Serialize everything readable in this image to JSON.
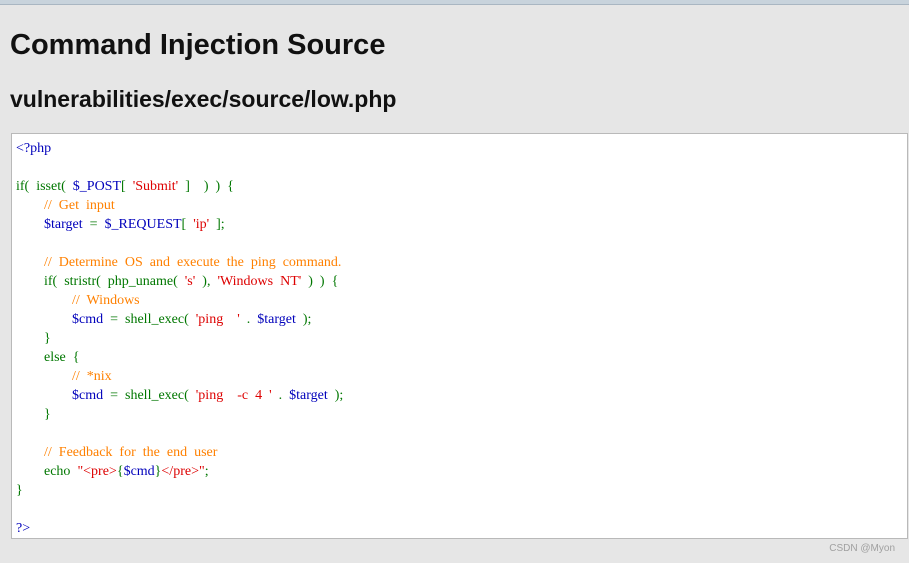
{
  "page": {
    "title": "Command Injection Source",
    "file_path": "vulnerabilities/exec/source/low.php"
  },
  "code": {
    "lines": [
      [
        {
          "t": "<?php",
          "c": "tag"
        }
      ],
      [],
      [
        {
          "t": "if(  ",
          "c": "kw"
        },
        {
          "t": "isset",
          "c": "kw"
        },
        {
          "t": "(  ",
          "c": "kw"
        },
        {
          "t": "$_POST",
          "c": "var"
        },
        {
          "t": "[  ",
          "c": "kw"
        },
        {
          "t": "'Submit'",
          "c": "str"
        },
        {
          "t": "  ]    )  )  {",
          "c": "kw"
        }
      ],
      [
        {
          "t": "        ",
          "c": "kw"
        },
        {
          "t": "//  Get  input",
          "c": "cm"
        }
      ],
      [
        {
          "t": "        ",
          "c": "kw"
        },
        {
          "t": "$target",
          "c": "var"
        },
        {
          "t": "  =  ",
          "c": "kw"
        },
        {
          "t": "$_REQUEST",
          "c": "var"
        },
        {
          "t": "[  ",
          "c": "kw"
        },
        {
          "t": "'ip'",
          "c": "str"
        },
        {
          "t": "  ];",
          "c": "kw"
        }
      ],
      [],
      [
        {
          "t": "        ",
          "c": "kw"
        },
        {
          "t": "//  Determine  OS  and  execute  the  ping  command.",
          "c": "cm"
        }
      ],
      [
        {
          "t": "        if(  ",
          "c": "kw"
        },
        {
          "t": "stristr",
          "c": "kw"
        },
        {
          "t": "(  ",
          "c": "kw"
        },
        {
          "t": "php_uname",
          "c": "kw"
        },
        {
          "t": "(  ",
          "c": "kw"
        },
        {
          "t": "'s'",
          "c": "str"
        },
        {
          "t": "  ),  ",
          "c": "kw"
        },
        {
          "t": "'Windows  NT'",
          "c": "str"
        },
        {
          "t": "  )  )  {",
          "c": "kw"
        }
      ],
      [
        {
          "t": "                ",
          "c": "kw"
        },
        {
          "t": "//  Windows",
          "c": "cm"
        }
      ],
      [
        {
          "t": "                ",
          "c": "kw"
        },
        {
          "t": "$cmd",
          "c": "var"
        },
        {
          "t": "  =  ",
          "c": "kw"
        },
        {
          "t": "shell_exec",
          "c": "kw"
        },
        {
          "t": "(  ",
          "c": "kw"
        },
        {
          "t": "'ping    '",
          "c": "str"
        },
        {
          "t": "  .  ",
          "c": "kw"
        },
        {
          "t": "$target",
          "c": "var"
        },
        {
          "t": "  );",
          "c": "kw"
        }
      ],
      [
        {
          "t": "        }",
          "c": "kw"
        }
      ],
      [
        {
          "t": "        else  {",
          "c": "kw"
        }
      ],
      [
        {
          "t": "                ",
          "c": "kw"
        },
        {
          "t": "//  *nix",
          "c": "cm"
        }
      ],
      [
        {
          "t": "                ",
          "c": "kw"
        },
        {
          "t": "$cmd",
          "c": "var"
        },
        {
          "t": "  =  ",
          "c": "kw"
        },
        {
          "t": "shell_exec",
          "c": "kw"
        },
        {
          "t": "(  ",
          "c": "kw"
        },
        {
          "t": "'ping    -c  4  '",
          "c": "str"
        },
        {
          "t": "  .  ",
          "c": "kw"
        },
        {
          "t": "$target",
          "c": "var"
        },
        {
          "t": "  );",
          "c": "kw"
        }
      ],
      [
        {
          "t": "        }",
          "c": "kw"
        }
      ],
      [],
      [
        {
          "t": "        ",
          "c": "kw"
        },
        {
          "t": "//  Feedback  for  the  end  user",
          "c": "cm"
        }
      ],
      [
        {
          "t": "        echo  ",
          "c": "kw"
        },
        {
          "t": "\"<pre>",
          "c": "str"
        },
        {
          "t": "{",
          "c": "kw"
        },
        {
          "t": "$cmd",
          "c": "var"
        },
        {
          "t": "}",
          "c": "kw"
        },
        {
          "t": "</pre>\"",
          "c": "str"
        },
        {
          "t": ";",
          "c": "kw"
        }
      ],
      [
        {
          "t": "}",
          "c": "kw"
        }
      ],
      [],
      [
        {
          "t": "?>",
          "c": "tag"
        }
      ]
    ]
  },
  "watermark": "CSDN @Myon⁠",
  "colors": {
    "keyword": "#007700",
    "variable": "#0000bb",
    "string": "#dd0000",
    "comment": "#ff8000",
    "background": "#e6e6e6"
  }
}
